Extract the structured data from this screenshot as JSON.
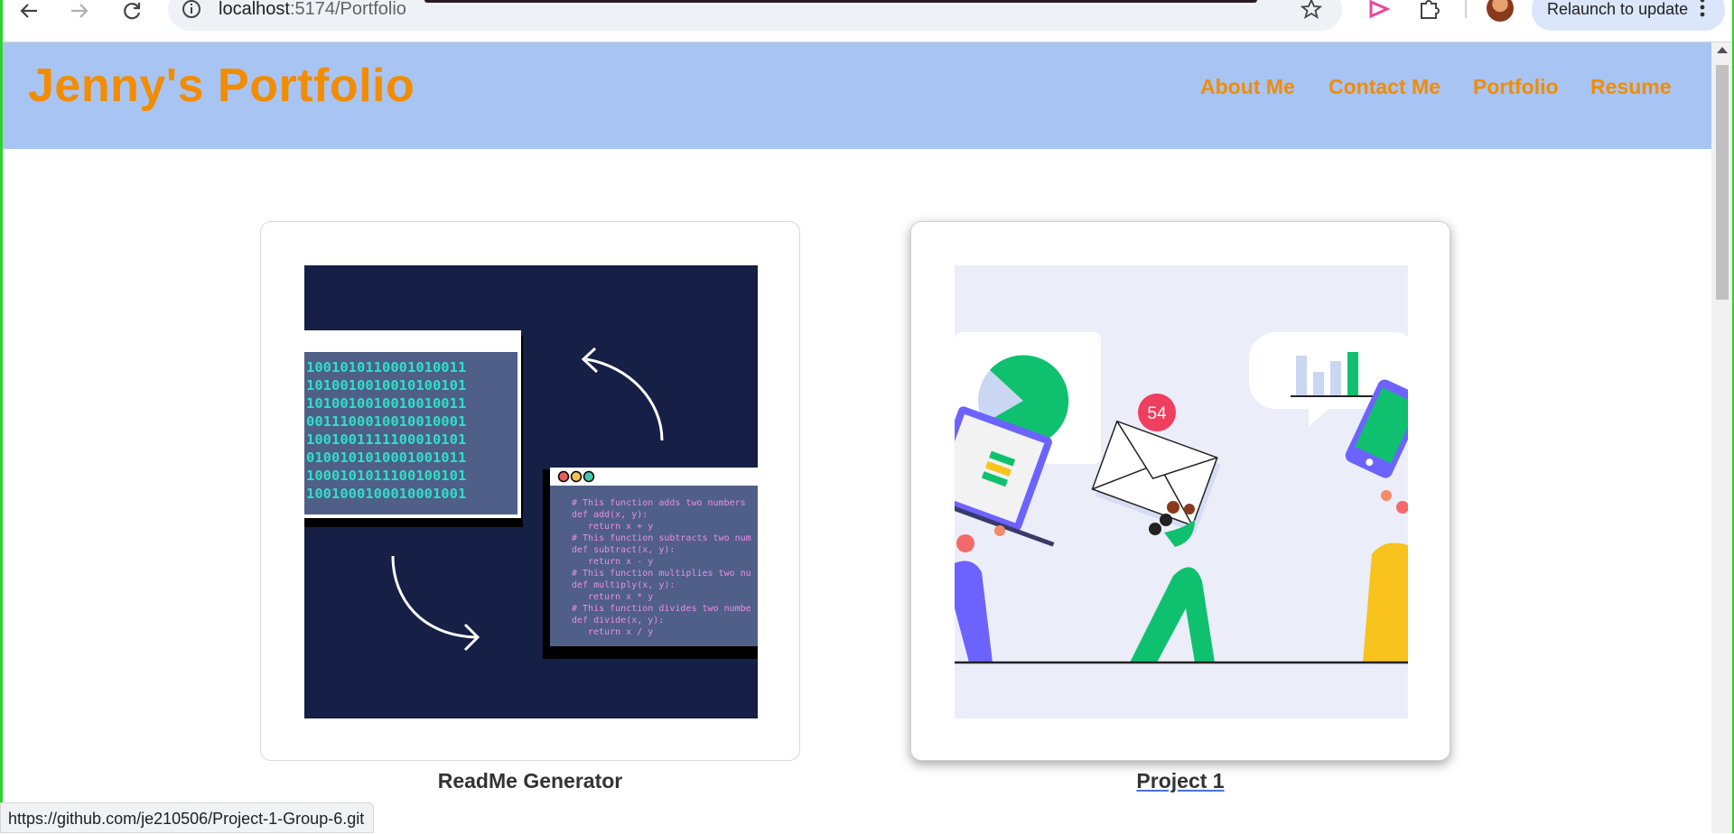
{
  "browser": {
    "url_host": "localhost",
    "url_path": ":5174/Portfolio",
    "relaunch_label": "Relaunch to update",
    "status_url": "https://github.com/je210506/Project-1-Group-6.git"
  },
  "header": {
    "brand": "Jenny's Portfolio",
    "nav": [
      "About Me",
      "Contact Me",
      "Portfolio",
      "Resume"
    ]
  },
  "projects": [
    {
      "title": "ReadMe Generator",
      "image": "binary-to-code-illustration"
    },
    {
      "title": "Project 1",
      "image": "team-notification-illustration",
      "badge": "54"
    }
  ],
  "colors": {
    "header_bg": "#a8c4f3",
    "brand_orange": "#f28c00"
  }
}
